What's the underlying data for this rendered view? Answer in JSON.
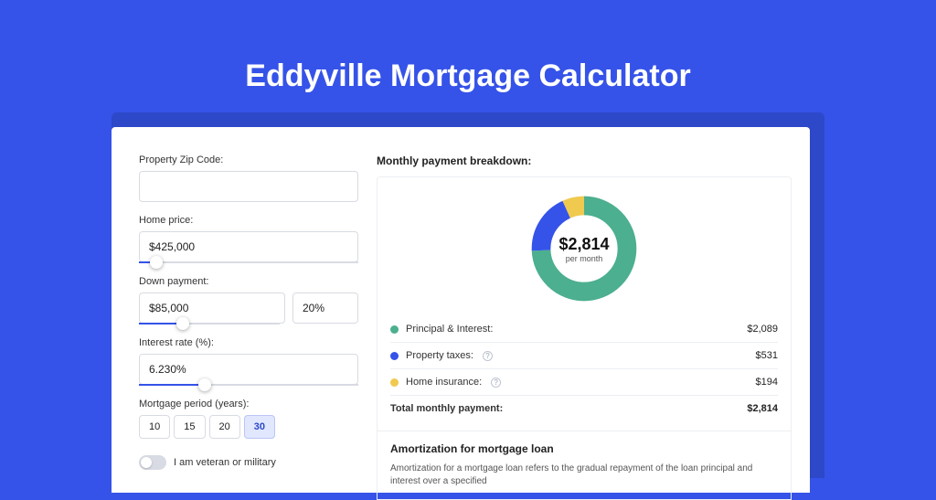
{
  "title": "Eddyville Mortgage Calculator",
  "form": {
    "zip_label": "Property Zip Code:",
    "zip_value": "",
    "home_price_label": "Home price:",
    "home_price_value": "$425,000",
    "down_payment_label": "Down payment:",
    "down_payment_value": "$85,000",
    "down_payment_pct": "20%",
    "interest_label": "Interest rate (%):",
    "interest_value": "6.230%",
    "period_label": "Mortgage period (years):",
    "periods": [
      "10",
      "15",
      "20",
      "30"
    ],
    "period_selected": "30",
    "veteran_label": "I am veteran or military"
  },
  "breakdown": {
    "title": "Monthly payment breakdown:",
    "total_value": "$2,814",
    "total_sub": "per month",
    "items": [
      {
        "label": "Principal & Interest:",
        "value": "$2,089",
        "color": "#4caf8f",
        "info": false
      },
      {
        "label": "Property taxes:",
        "value": "$531",
        "color": "#3553e8",
        "info": true
      },
      {
        "label": "Home insurance:",
        "value": "$194",
        "color": "#f0c94f",
        "info": true
      }
    ],
    "total_label": "Total monthly payment:",
    "total_row_value": "$2,814"
  },
  "amort": {
    "title": "Amortization for mortgage loan",
    "text": "Amortization for a mortgage loan refers to the gradual repayment of the loan principal and interest over a specified"
  },
  "chart_data": {
    "type": "pie",
    "title": "Monthly payment breakdown",
    "categories": [
      "Principal & Interest",
      "Property taxes",
      "Home insurance"
    ],
    "values": [
      2089,
      531,
      194
    ],
    "colors": [
      "#4caf8f",
      "#3553e8",
      "#f0c94f"
    ],
    "total": 2814
  }
}
